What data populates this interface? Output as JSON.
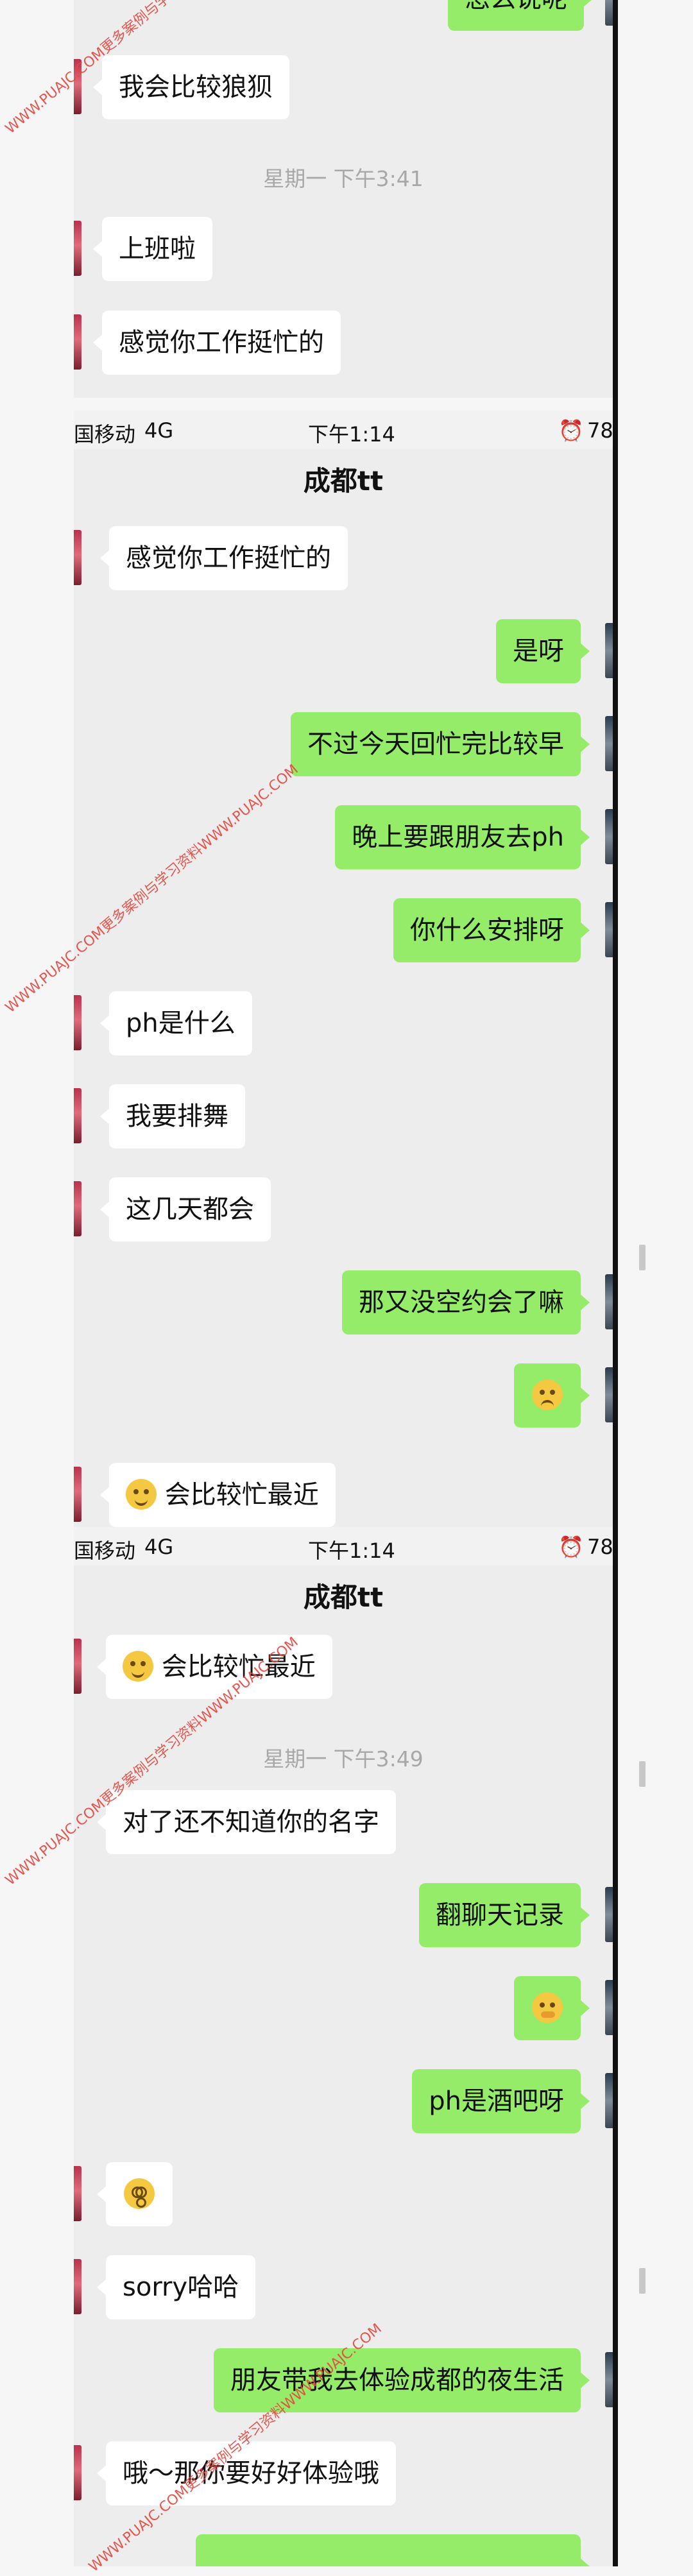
{
  "watermark": "WWW.PUAJC.COM更多案例与学习资料WWW.PUAJC.COM",
  "status": {
    "carrier": "国移动",
    "network": "4G",
    "time": "下午1:14",
    "battery": "78"
  },
  "chat_title": "成都tt",
  "panel1": {
    "sent_partial": "怎么说呢",
    "msg1": "我会比较狼狈",
    "time1": "星期一 下午3:41",
    "msg2": "上班啦",
    "msg3": "感觉你工作挺忙的"
  },
  "panel2": {
    "msg1": "感觉你工作挺忙的",
    "msg2": "是呀",
    "msg3": "不过今天回忙完比较早",
    "msg4": "晚上要跟朋友去ph",
    "msg5": "你什么安排呀",
    "msg6": "ph是什么",
    "msg7": "我要排舞",
    "msg8": "这几天都会",
    "msg9": "那又没空约会了嘛",
    "msg11": "会比较忙最近"
  },
  "panel3": {
    "msg1": "会比较忙最近",
    "time1": "星期一 下午3:49",
    "msg2": "对了还不知道你的名字",
    "msg3": "翻聊天记录",
    "msg5": "ph是酒吧呀",
    "msg7": "sorry哈哈",
    "msg8": "朋友带我去体验成都的夜生活",
    "msg9": "哦～那你要好好体验哦"
  },
  "icons": [
    "smile-emoji-icon",
    "sad-emoji-icon",
    "cover-mouth-emoji-icon",
    "dizzy-emoji-icon",
    "alarm-icon"
  ],
  "colors": {
    "sent_bubble": "#95ec69",
    "received_bubble": "#ffffff",
    "chat_bg": "#ededed"
  }
}
